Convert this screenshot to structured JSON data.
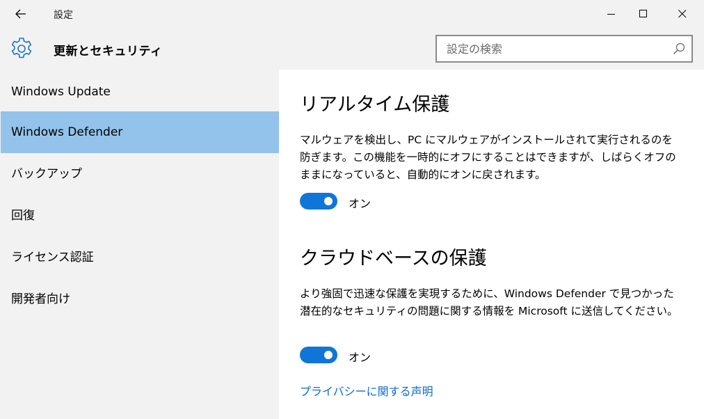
{
  "window": {
    "title": "設定",
    "accent_color": "#0f76d7",
    "selected_color": "#93c3ea"
  },
  "header": {
    "title": "更新とセキュリティ",
    "icon": "gear-icon"
  },
  "search": {
    "placeholder": "設定の検索",
    "value": ""
  },
  "sidebar": {
    "items": [
      {
        "label": "Windows Update",
        "selected": false
      },
      {
        "label": "Windows Defender",
        "selected": true
      },
      {
        "label": "バックアップ",
        "selected": false
      },
      {
        "label": "回復",
        "selected": false
      },
      {
        "label": "ライセンス認証",
        "selected": false
      },
      {
        "label": "開発者向け",
        "selected": false
      }
    ]
  },
  "main": {
    "realtime": {
      "title": "リアルタイム保護",
      "description": "マルウェアを検出し、PC にマルウェアがインストールされて実行されるのを防ぎます。この機能を一時的にオフにすることはできますが、しばらくオフのままになっていると、自動的にオンに戻されます。",
      "toggle_on": true,
      "toggle_label": "オン"
    },
    "cloud": {
      "title": "クラウドベースの保護",
      "description": "より強固で迅速な保護を実現するために、Windows Defender で見つかった潜在的なセキュリティの問題に関する情報を Microsoft に送信してください。",
      "toggle_on": true,
      "toggle_label": "オン"
    },
    "privacy_link": "プライバシーに関する声明"
  }
}
